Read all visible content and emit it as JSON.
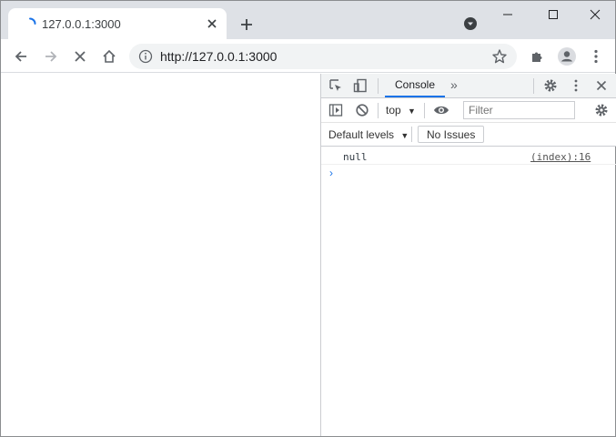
{
  "colors": {
    "tabstrip": "#dee1e6",
    "accent": "#1a73e8",
    "icon": "#5f6368"
  },
  "tab": {
    "title": "127.0.0.1:3000",
    "spinner_icon": "loading-spinner-icon",
    "close_icon": "close-icon"
  },
  "window_controls": {
    "minimize_icon": "minimize-icon",
    "maximize_icon": "maximize-icon",
    "close_icon": "close-icon"
  },
  "toolbar": {
    "back_icon": "back-arrow-icon",
    "forward_icon": "forward-arrow-icon",
    "stop_icon": "stop-icon",
    "home_icon": "home-icon",
    "url": "http://127.0.0.1:3000",
    "info_icon": "info-icon",
    "star_icon": "star-icon",
    "extensions_icon": "puzzle-icon",
    "profile_icon": "avatar-icon",
    "menu_icon": "kebab-menu-icon"
  },
  "devtools": {
    "tabs": {
      "console_label": "Console",
      "more_label": "»"
    },
    "console_toolbar": {
      "context": "top",
      "filter_placeholder": "Filter",
      "levels_label": "Default levels",
      "issues_label": "No Issues"
    },
    "log": [
      {
        "message": "null",
        "source": "(index):16"
      }
    ],
    "prompt": "›"
  }
}
